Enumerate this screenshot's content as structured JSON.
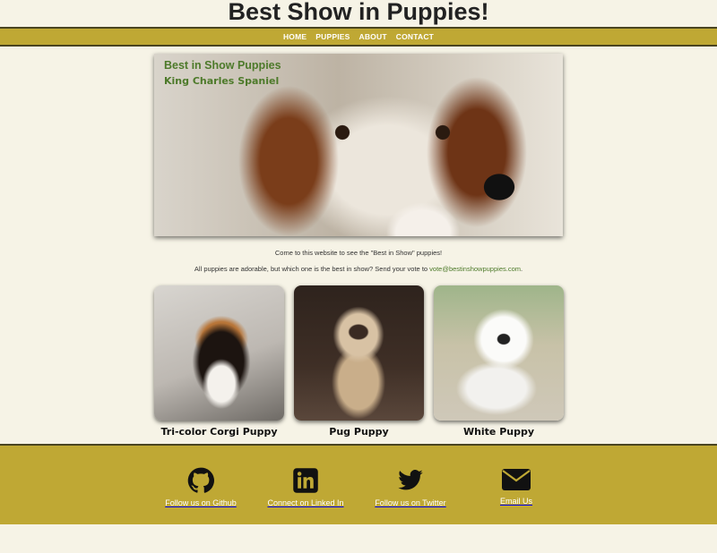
{
  "header": {
    "title": "Best Show in Puppies!"
  },
  "nav": {
    "items": [
      "HOME",
      "PUPPIES",
      "ABOUT",
      "CONTACT"
    ]
  },
  "hero": {
    "title": "Best in Show Puppies",
    "subtitle": "King Charles Spaniel"
  },
  "intro": {
    "line1": "Come to this website to see the \"Best in Show\" puppies!",
    "line2_prefix": "All puppies are adorable, but which one is the best in show? Send your vote to ",
    "email": "vote@bestinshowpuppies.com",
    "line2_suffix": "."
  },
  "cards": [
    {
      "label": "Tri-color Corgi Puppy"
    },
    {
      "label": "Pug Puppy"
    },
    {
      "label": "White Puppy"
    }
  ],
  "footer": {
    "links": [
      {
        "label": "Follow us on Github",
        "icon": "github-icon"
      },
      {
        "label": "Connect on Linked In",
        "icon": "linkedin-icon"
      },
      {
        "label": "Follow us on Twitter",
        "icon": "twitter-icon"
      },
      {
        "label": "Email Us",
        "icon": "envelope-icon"
      }
    ]
  },
  "colors": {
    "accent": "#bfa834",
    "green_text": "#4d7a2a",
    "background": "#f6f3e6"
  }
}
